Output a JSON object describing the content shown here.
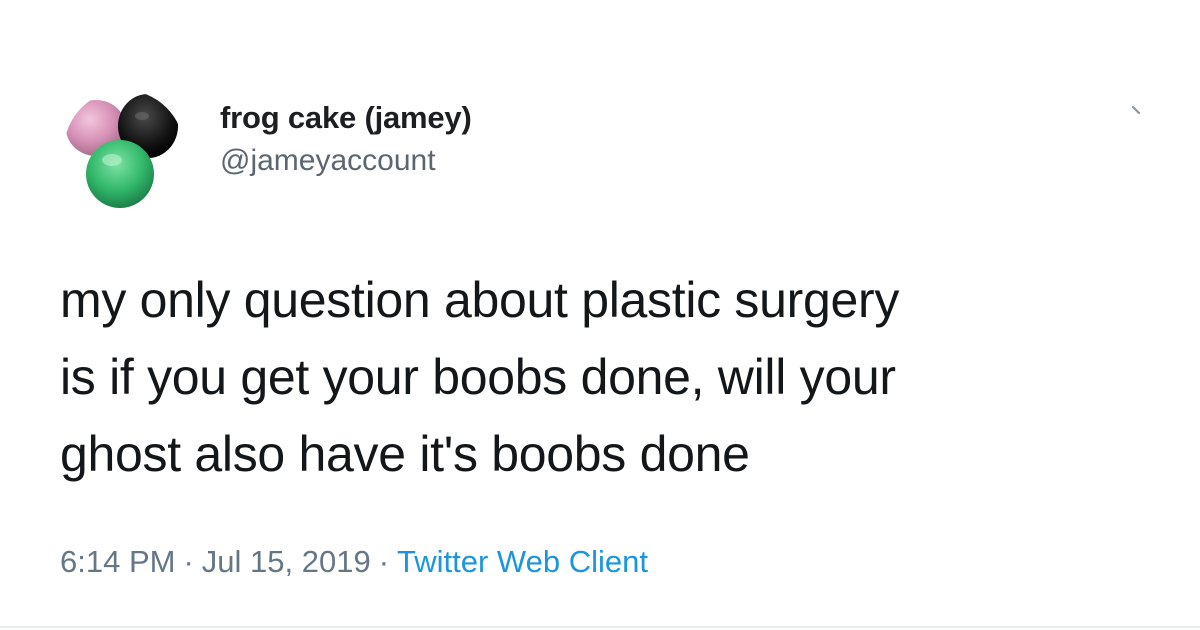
{
  "author": {
    "display_name": "frog cake (jamey)",
    "handle": "@jameyaccount",
    "avatar_icon": "cakes-avatar-icon"
  },
  "tweet": {
    "lines": [
      "my only question about plastic surgery",
      "is if you get your boobs done, will your",
      "ghost also have it's boobs done"
    ]
  },
  "meta": {
    "time": "6:14 PM",
    "date": "Jul 15, 2019",
    "separator": "·",
    "source": "Twitter Web Client"
  },
  "icons": {
    "menu": "chevron-down-icon"
  },
  "colors": {
    "text": "#14171a",
    "secondary": "#657786",
    "link": "#1b95e0",
    "background": "#ffffff"
  }
}
